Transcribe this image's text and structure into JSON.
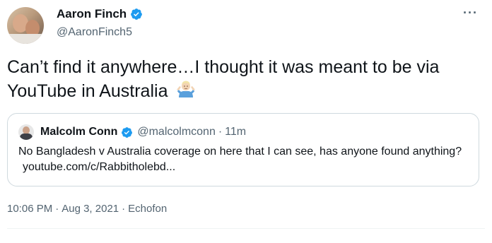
{
  "author": {
    "display_name": "Aaron Finch",
    "handle": "@AaronFinch5",
    "verified": true
  },
  "more_menu": {
    "icon": "more-horizontal-icon",
    "label": "···"
  },
  "tweet": {
    "text": "Can’t find it anywhere…I thought it was meant to be via YouTube in Australia",
    "emoji": "shrug-emoji"
  },
  "quoted_tweet": {
    "display_name": "Malcolm Conn",
    "handle": "@malcolmconn",
    "separator": "·",
    "time": "11m",
    "verified": true,
    "text": "No Bangladesh v Australia coverage on here that I can see, has anyone found anything?",
    "link": "youtube.com/c/Rabbitholebd..."
  },
  "meta": {
    "time": "10:06 PM",
    "separator1": "·",
    "date": "Aug 3, 2021",
    "separator2": "·",
    "source": "Echofon"
  },
  "colors": {
    "verified_blue": "#1d9bf0",
    "secondary_text": "#536471",
    "border": "#cfd9de"
  }
}
